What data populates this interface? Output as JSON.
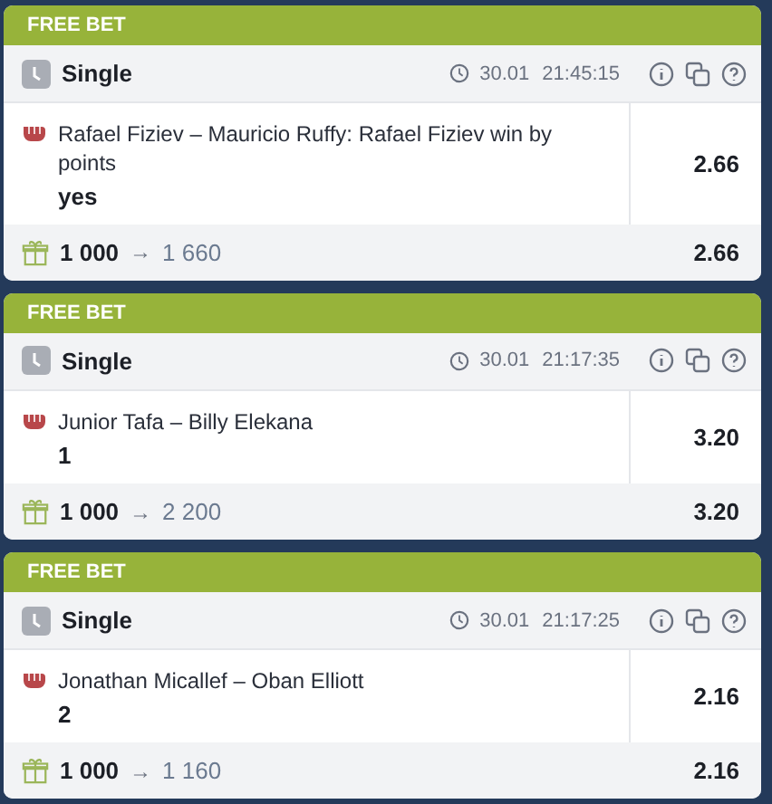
{
  "bets": [
    {
      "badge": "FREE BET",
      "type": "Single",
      "date": "30.01",
      "time": "21:45:15",
      "event": "Rafael Fiziev – Mauricio Ruffy: Rafael Fiziev win by points",
      "outcome": "yes",
      "odds": "2.66",
      "stake": "1 000",
      "arrow": "→",
      "payout": "1 660",
      "total_odds": "2.66"
    },
    {
      "badge": "FREE BET",
      "type": "Single",
      "date": "30.01",
      "time": "21:17:35",
      "event": "Junior Tafa – Billy Elekana",
      "outcome": "1",
      "odds": "3.20",
      "stake": "1 000",
      "arrow": "→",
      "payout": "2 200",
      "total_odds": "3.20"
    },
    {
      "badge": "FREE BET",
      "type": "Single",
      "date": "30.01",
      "time": "21:17:25",
      "event": "Jonathan Micallef – Oban Elliott",
      "outcome": "2",
      "odds": "2.16",
      "stake": "1 000",
      "arrow": "→",
      "payout": "1 160",
      "total_odds": "2.16"
    }
  ]
}
